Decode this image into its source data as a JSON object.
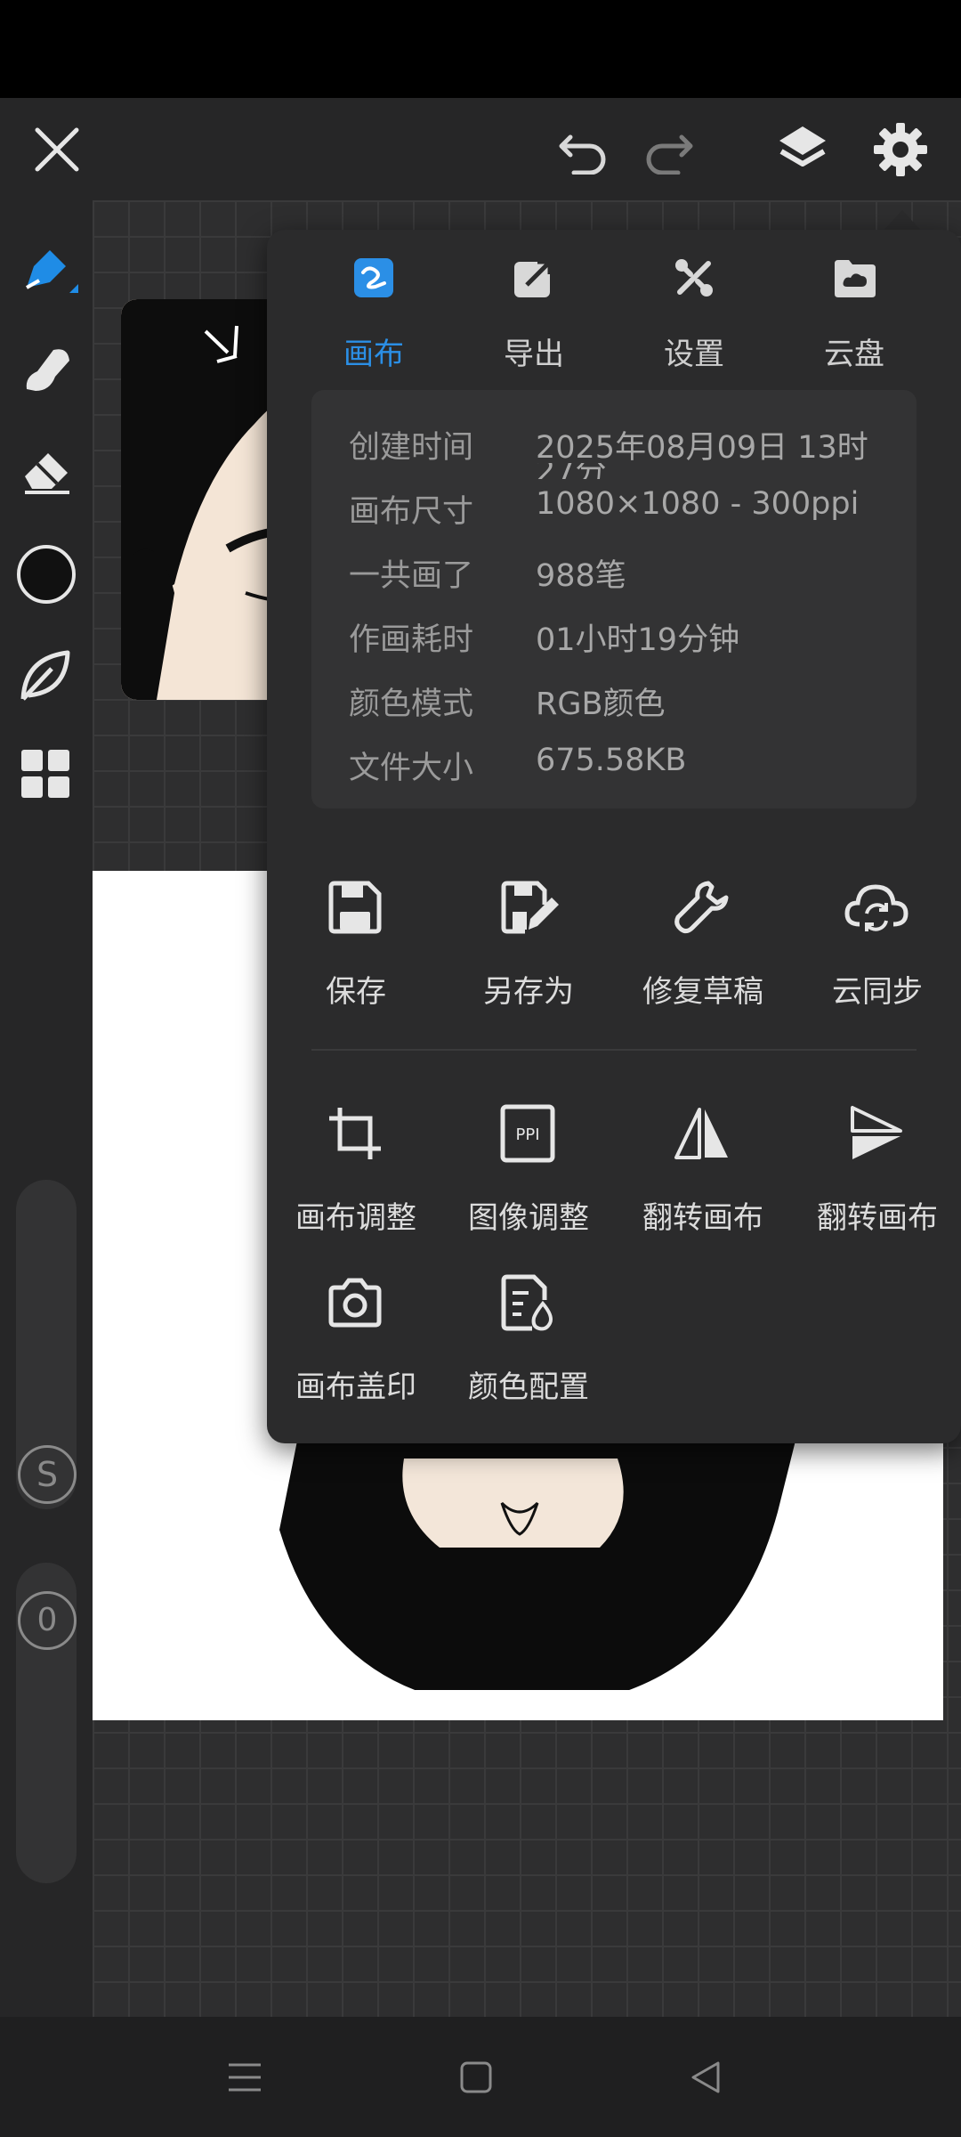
{
  "colors": {
    "accent": "#2b8fe6",
    "panel": "#2b2b2c",
    "info_panel": "#333334"
  },
  "topbar": {
    "icons": [
      "close-icon",
      "undo-icon",
      "redo-icon",
      "layers-icon",
      "gear-icon"
    ]
  },
  "tools": [
    "brush-icon",
    "smudge-icon",
    "eraser-icon",
    "color-circle-icon",
    "leaf-icon",
    "grid-icon"
  ],
  "sliders": {
    "size_label": "S",
    "opacity_label": "0"
  },
  "popup": {
    "tabs": [
      {
        "label": "画布",
        "icon": "canvas-icon"
      },
      {
        "label": "导出",
        "icon": "export-icon"
      },
      {
        "label": "设置",
        "icon": "tools-icon"
      },
      {
        "label": "云盘",
        "icon": "cloud-folder-icon"
      }
    ],
    "info": [
      {
        "key": "创建时间",
        "value": "2025年08月09日 13时"
      },
      {
        "key": "画布尺寸",
        "value": "1080×1080 - 300ppi"
      },
      {
        "key": "一共画了",
        "value": "988笔"
      },
      {
        "key": "作画耗时",
        "value": "01小时19分钟"
      },
      {
        "key": "颜色模式",
        "value": "RGB颜色"
      },
      {
        "key": "文件大小",
        "value": "675.58KB"
      }
    ],
    "info_cut": "27分",
    "actions_row1": [
      {
        "label": "保存",
        "icon": "save-icon"
      },
      {
        "label": "另存为",
        "icon": "save-as-icon"
      },
      {
        "label": "修复草稿",
        "icon": "wrench-icon"
      },
      {
        "label": "云同步",
        "icon": "cloud-sync-icon"
      }
    ],
    "actions_row2": [
      {
        "label": "画布调整",
        "icon": "crop-icon"
      },
      {
        "label": "图像调整",
        "icon": "ppi-icon"
      },
      {
        "label": "翻转画布",
        "icon": "flip-horizontal-icon"
      },
      {
        "label": "翻转画布",
        "icon": "flip-vertical-icon"
      }
    ],
    "actions_row3": [
      {
        "label": "画布盖印",
        "icon": "camera-icon"
      },
      {
        "label": "颜色配置",
        "icon": "color-profile-icon"
      }
    ],
    "ppi_text": "PPI"
  },
  "navbar": {
    "icons": [
      "menu-icon",
      "home-icon",
      "back-icon"
    ]
  }
}
